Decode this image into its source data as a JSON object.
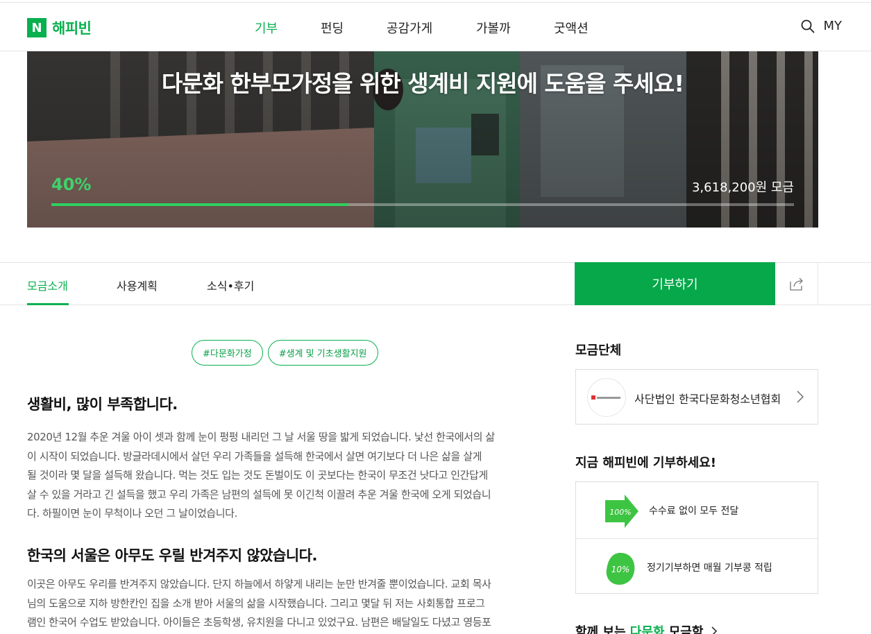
{
  "header": {
    "logo_letter": "N",
    "logo_text": "해피빈",
    "nav": [
      {
        "label": "기부",
        "active": true
      },
      {
        "label": "펀딩",
        "active": false
      },
      {
        "label": "공감가게",
        "active": false
      },
      {
        "label": "가볼까",
        "active": false
      },
      {
        "label": "굿액션",
        "active": false
      }
    ],
    "search_icon": "search-icon",
    "my_label": "MY"
  },
  "hero": {
    "title": "다문화 한부모가정을 위한 생계비 지원에 도움을 주세요!",
    "percent_label": "40%",
    "progress_fraction": 0.4,
    "amount_label": "3,618,200원 모금"
  },
  "tabs": {
    "items": [
      {
        "label": "모금소개",
        "active": true
      },
      {
        "label": "사용계획",
        "active": false
      },
      {
        "label": "소식•후기",
        "active": false
      }
    ],
    "donate_label": "기부하기",
    "share_icon": "share-icon"
  },
  "tags": [
    "#다문화가정",
    "#생계 및 기초생활지원"
  ],
  "story": {
    "heading1": "생활비, 많이 부족합니다.",
    "para1_lines": [
      "2020년 12월 추운 겨울 아이 셋과 함께 눈이 펑펑 내리던 그 날 서울 땅을 밟게 되었습니다. 낯선 한국에서의 삶",
      "이 시작이 되었습니다. 방글라데시에서 살던 우리 가족들을 설득해 한국에서 살면 여기보다 더 나은 삶을 살게",
      "될 것이라 몇 달을 설득해 왔습니다. 먹는 것도 입는 것도 돈벌이도 이 곳보다는 한국이 무조건 낫다고 인간답게",
      "살 수 있을 거라고 긴 설득을 했고 우리 가족은 남편의 설득에 못 이긴척 이끌려 추운 겨울 한국에 오게 되었습니",
      "다. 하필이면 눈이 무척이나 오던 그 날이었습니다."
    ],
    "heading2": "한국의 서울은 아무도 우릴 반겨주지 않았습니다.",
    "para2_lines": [
      "이곳은 아무도 우리를 반겨주지 않았습니다. 단지 하늘에서 하얗게 내리는 눈만 반겨줄 뿐이었습니다. 교회 목사",
      "님의 도움으로 지하 방한칸인 집을 소개 받아 서울의 삶을 시작했습니다. 그리고 몇달 뒤 저는 사회통합 프로그",
      "램인 한국어 수업도 받았습니다. 아이들은 초등학생, 유치원을 다니고 있었구요. 남편은 배달일도 다녔고 영등포"
    ]
  },
  "sidebar": {
    "org_section_title": "모금단체",
    "org_name": "사단법인 한국다문화청소년협회",
    "donate_section_title": "지금 해피빈에 기부하세요!",
    "features": [
      {
        "icon": "100-percent-arrow-icon",
        "icon_text": "100%",
        "text": "수수료 없이 모두 전달"
      },
      {
        "icon": "10-percent-bean-icon",
        "icon_text": "10%",
        "text": "정기기부하면 매월 기부콩 적립"
      }
    ],
    "related_prefix": "함께 보는 ",
    "related_highlight": "다문화",
    "related_suffix": " 모금함"
  },
  "colors": {
    "brand_green": "#08b04e",
    "donate_button": "#06a84a",
    "progress_fill": "#2fd060"
  }
}
